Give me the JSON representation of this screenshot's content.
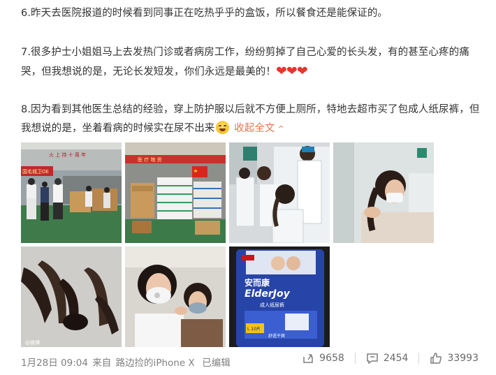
{
  "post": {
    "p6": "6.昨天去医院报道的时候看到同事正在吃热乎乎的盒饭，所以餐食还是能保证的。",
    "p7": "7.很多护士小姐姐马上去发热门诊或者病房工作，纷纷剪掉了自己心爱的长头发，有的甚至心疼的痛哭，但我想说的是，无论长发短发，你们永远是最美的！",
    "p7_emoji": "❤❤❤",
    "p8": "8.因为看到其他医生总结的经验，穿上防护服以后就不方便上厕所，特地去超市买了包成人纸尿裤，但我想说的是，坐着看病的时候实在尿不出来",
    "collapse_label": "收起全文",
    "collapse_chevron": "^"
  },
  "images": {
    "img1_banner": "国毛城卫OE",
    "img1_top": "火 上 持 十 周 年",
    "img2_banner": "医 疗 物 资",
    "img7_brand_cn": "安而康",
    "img7_brand_en": "ElderJoy",
    "img7_product": "成人纸尿裤",
    "img7_size": "L 10片",
    "img7_note": "舒适干爽",
    "watermark": "@微博"
  },
  "footer": {
    "date": "1月28日 09:04",
    "from_label": "来自",
    "source": "路边捡的iPhone X",
    "edited": "已编辑",
    "reposts": "9658",
    "comments": "2454",
    "likes": "33993"
  },
  "colors": {
    "text": "#333333",
    "meta": "#808080",
    "link": "#eb7350",
    "heart": "#e8352f"
  }
}
